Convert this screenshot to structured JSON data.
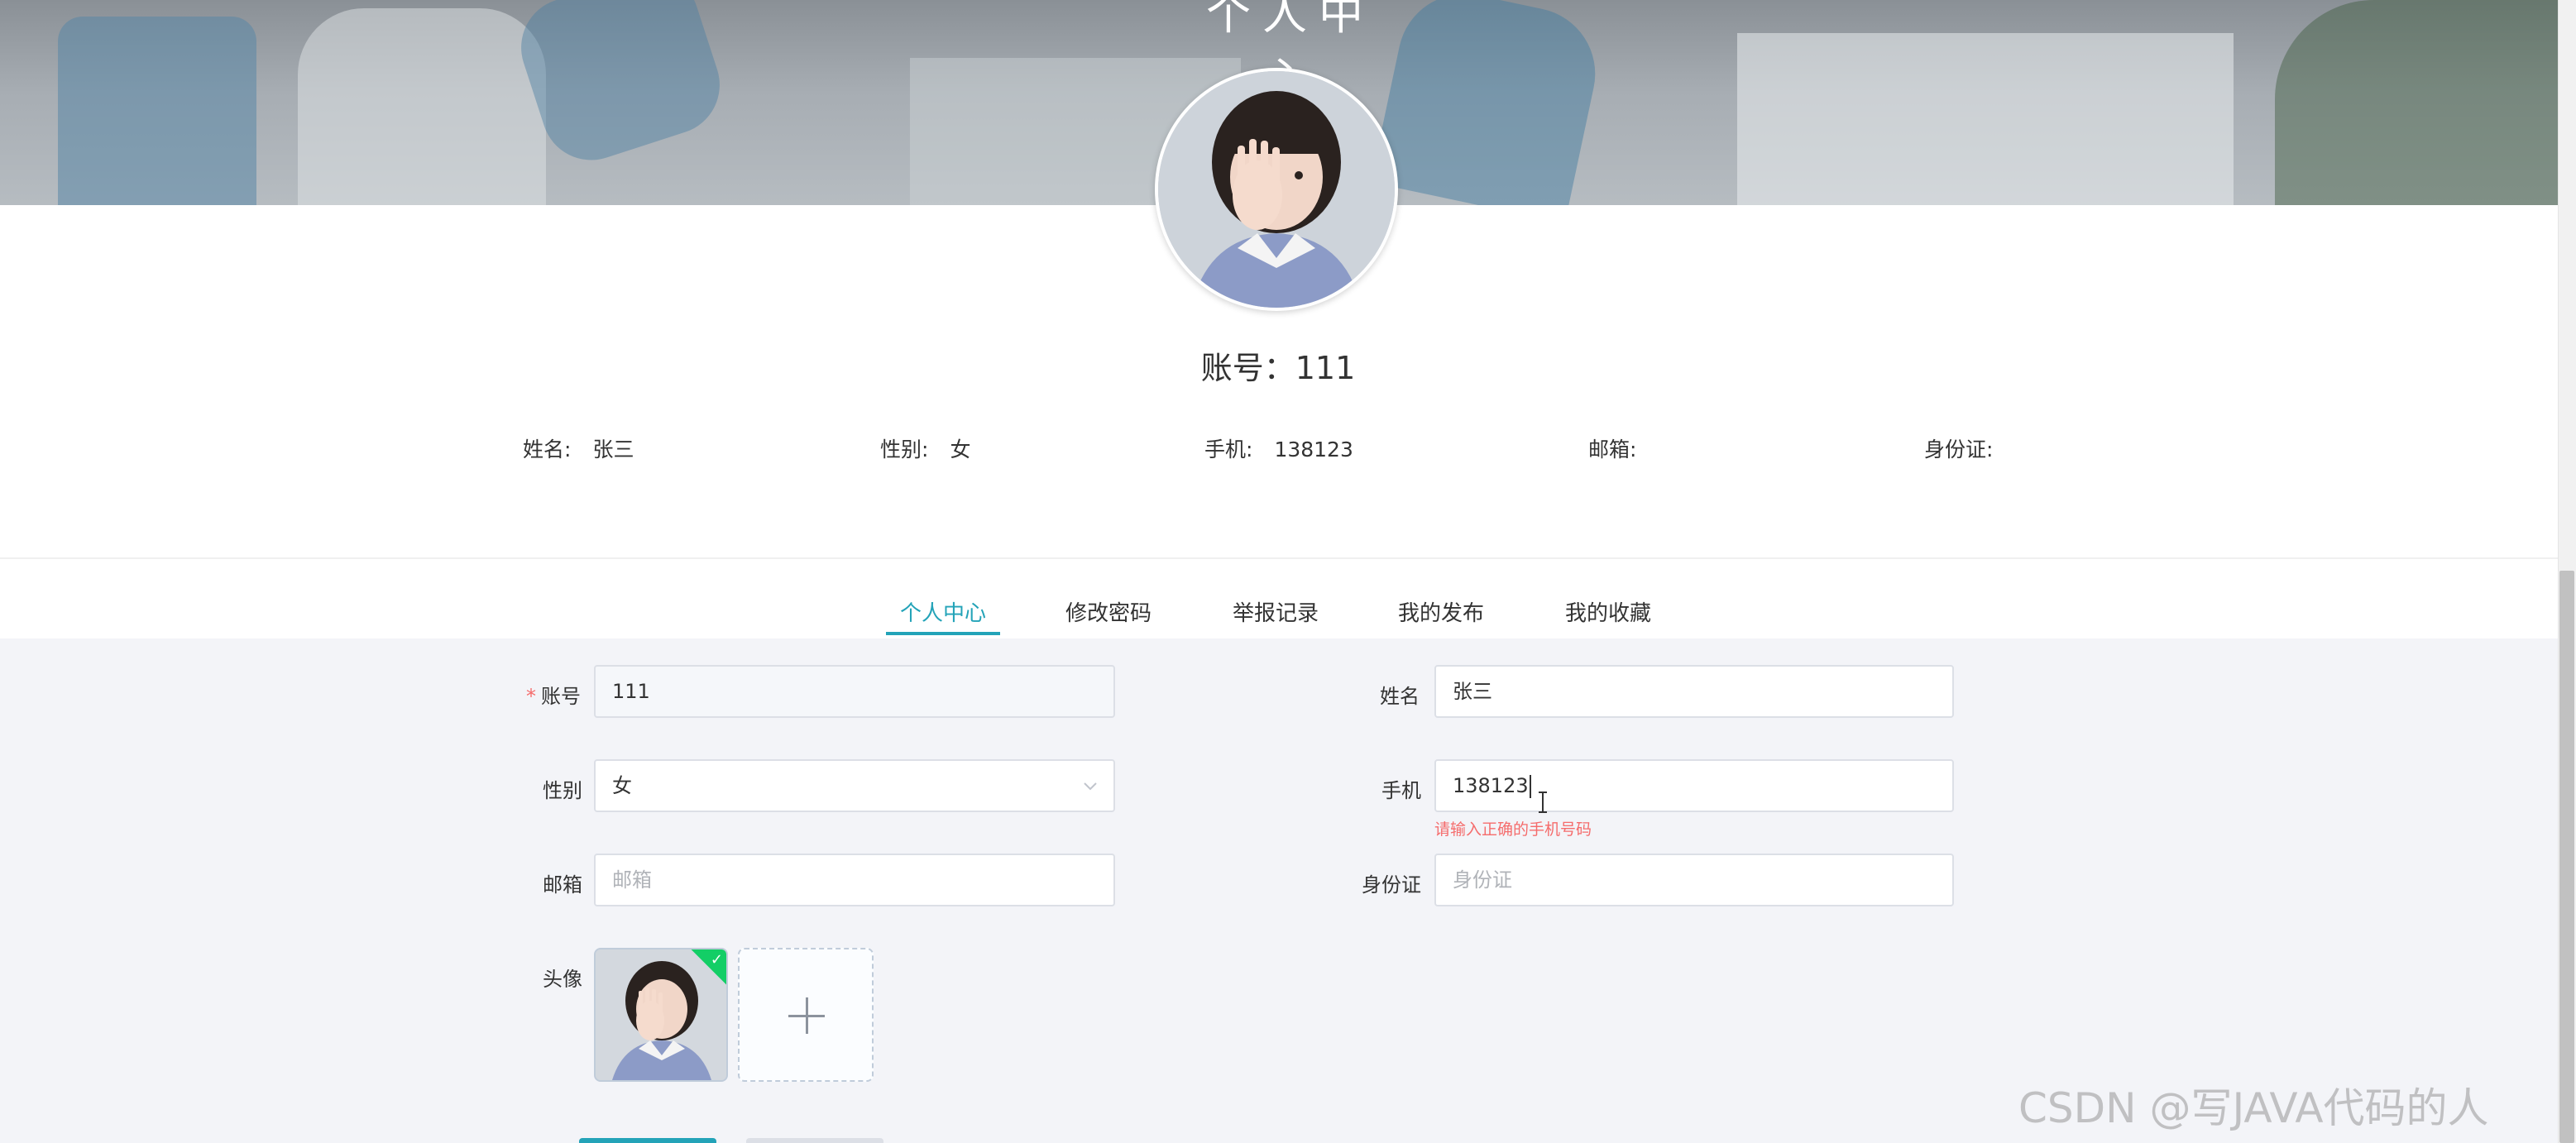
{
  "banner": {
    "title": "个人中心"
  },
  "profile": {
    "account_label": "账号：",
    "account_value": "111",
    "info": [
      {
        "label": "姓名:",
        "value": "张三"
      },
      {
        "label": "性别:",
        "value": "女"
      },
      {
        "label": "手机:",
        "value": "138123"
      },
      {
        "label": "邮箱:",
        "value": ""
      },
      {
        "label": "身份证:",
        "value": ""
      }
    ]
  },
  "tabs": [
    {
      "label": "个人中心",
      "active": true
    },
    {
      "label": "修改密码",
      "active": false
    },
    {
      "label": "举报记录",
      "active": false
    },
    {
      "label": "我的发布",
      "active": false
    },
    {
      "label": "我的收藏",
      "active": false
    }
  ],
  "form": {
    "account": {
      "label": "账号",
      "required_mark": "*",
      "value": "111"
    },
    "name": {
      "label": "姓名",
      "value": "张三"
    },
    "gender": {
      "label": "性别",
      "value": "女"
    },
    "phone": {
      "label": "手机",
      "value": "138123",
      "error": "请输入正确的手机号码"
    },
    "email": {
      "label": "邮箱",
      "placeholder": "邮箱"
    },
    "idcard": {
      "label": "身份证",
      "placeholder": "身份证"
    },
    "avatar": {
      "label": "头像"
    }
  },
  "watermark": "CSDN @写JAVA代码的人",
  "colors": {
    "accent": "#23a3b8",
    "error": "#f56c6c",
    "success": "#13ce66"
  },
  "icons": [
    "chevron-down-icon",
    "plus-icon",
    "check-icon"
  ]
}
